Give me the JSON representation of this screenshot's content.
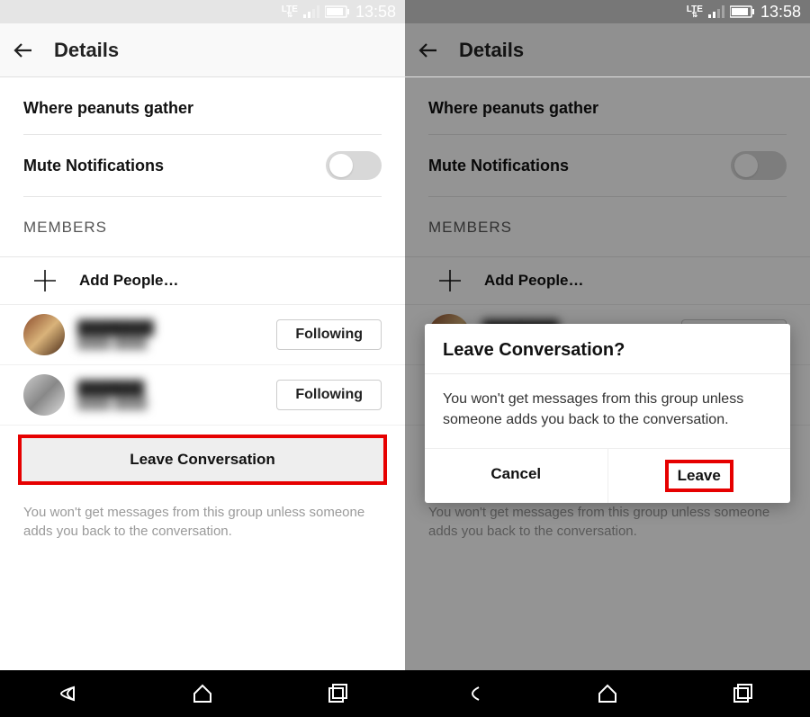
{
  "status": {
    "network": "LTE",
    "time": "13:58"
  },
  "header": {
    "title": "Details"
  },
  "conversation_name": "Where peanuts gather",
  "mute_label": "Mute Notifications",
  "section_members": "MEMBERS",
  "add_people_label": "Add People…",
  "members": [
    {
      "follow_label": "Following"
    },
    {
      "follow_label": "Following"
    }
  ],
  "leave_button": "Leave Conversation",
  "leave_footer": "You won't get messages from this group unless someone adds you back to the conversation.",
  "dialog": {
    "title": "Leave Conversation?",
    "body": "You won't get messages from this group unless someone adds you back to the conversation.",
    "cancel": "Cancel",
    "confirm": "Leave"
  }
}
